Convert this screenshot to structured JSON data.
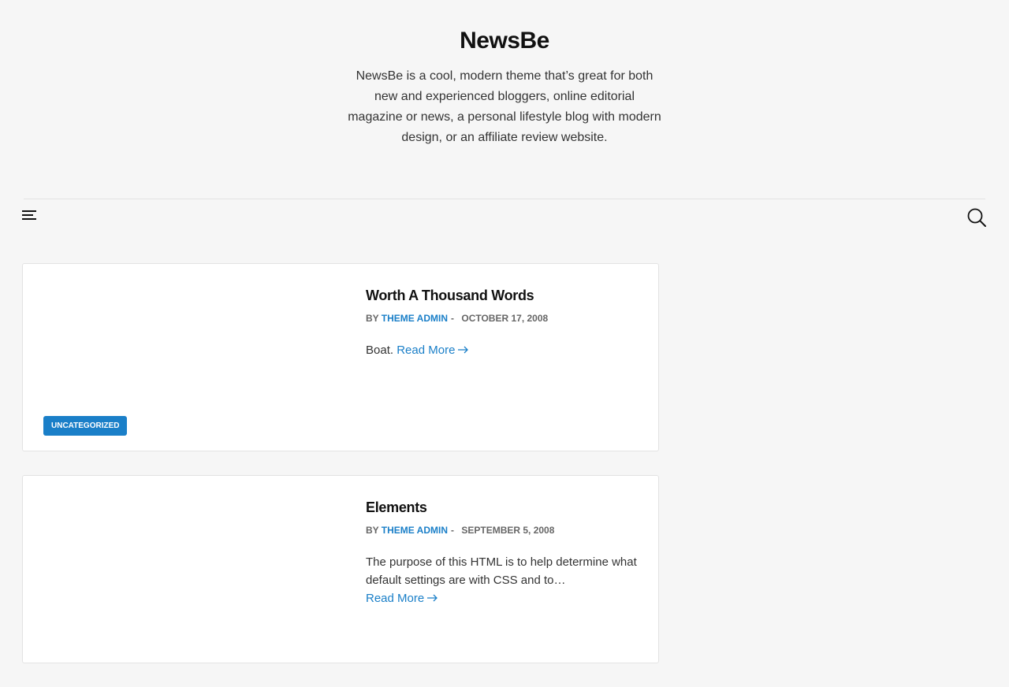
{
  "site": {
    "title": "NewsBe",
    "description": "NewsBe is a cool, modern theme that’s great for both new and experienced bloggers, online editorial magazine or news, a personal lifestyle blog with modern design, or an affiliate review website."
  },
  "nav": {
    "menu_icon": "hamburger-menu-icon",
    "search_icon": "search-icon"
  },
  "posts": [
    {
      "title": "Worth A Thousand Words",
      "by": "BY",
      "author": "THEME ADMIN",
      "separator": "-",
      "date": "OCTOBER 17, 2008",
      "excerpt": "Boat.",
      "read_more": "Read More",
      "category": "UNCATEGORIZED"
    },
    {
      "title": "Elements",
      "by": "BY",
      "author": "THEME ADMIN",
      "separator": "-",
      "date": "SEPTEMBER 5, 2008",
      "excerpt": "The purpose of this HTML is to help determine what default settings are with CSS and to…",
      "read_more": "Read More"
    }
  ],
  "colors": {
    "accent": "#1a7fc8",
    "background": "#f6f6f6"
  }
}
